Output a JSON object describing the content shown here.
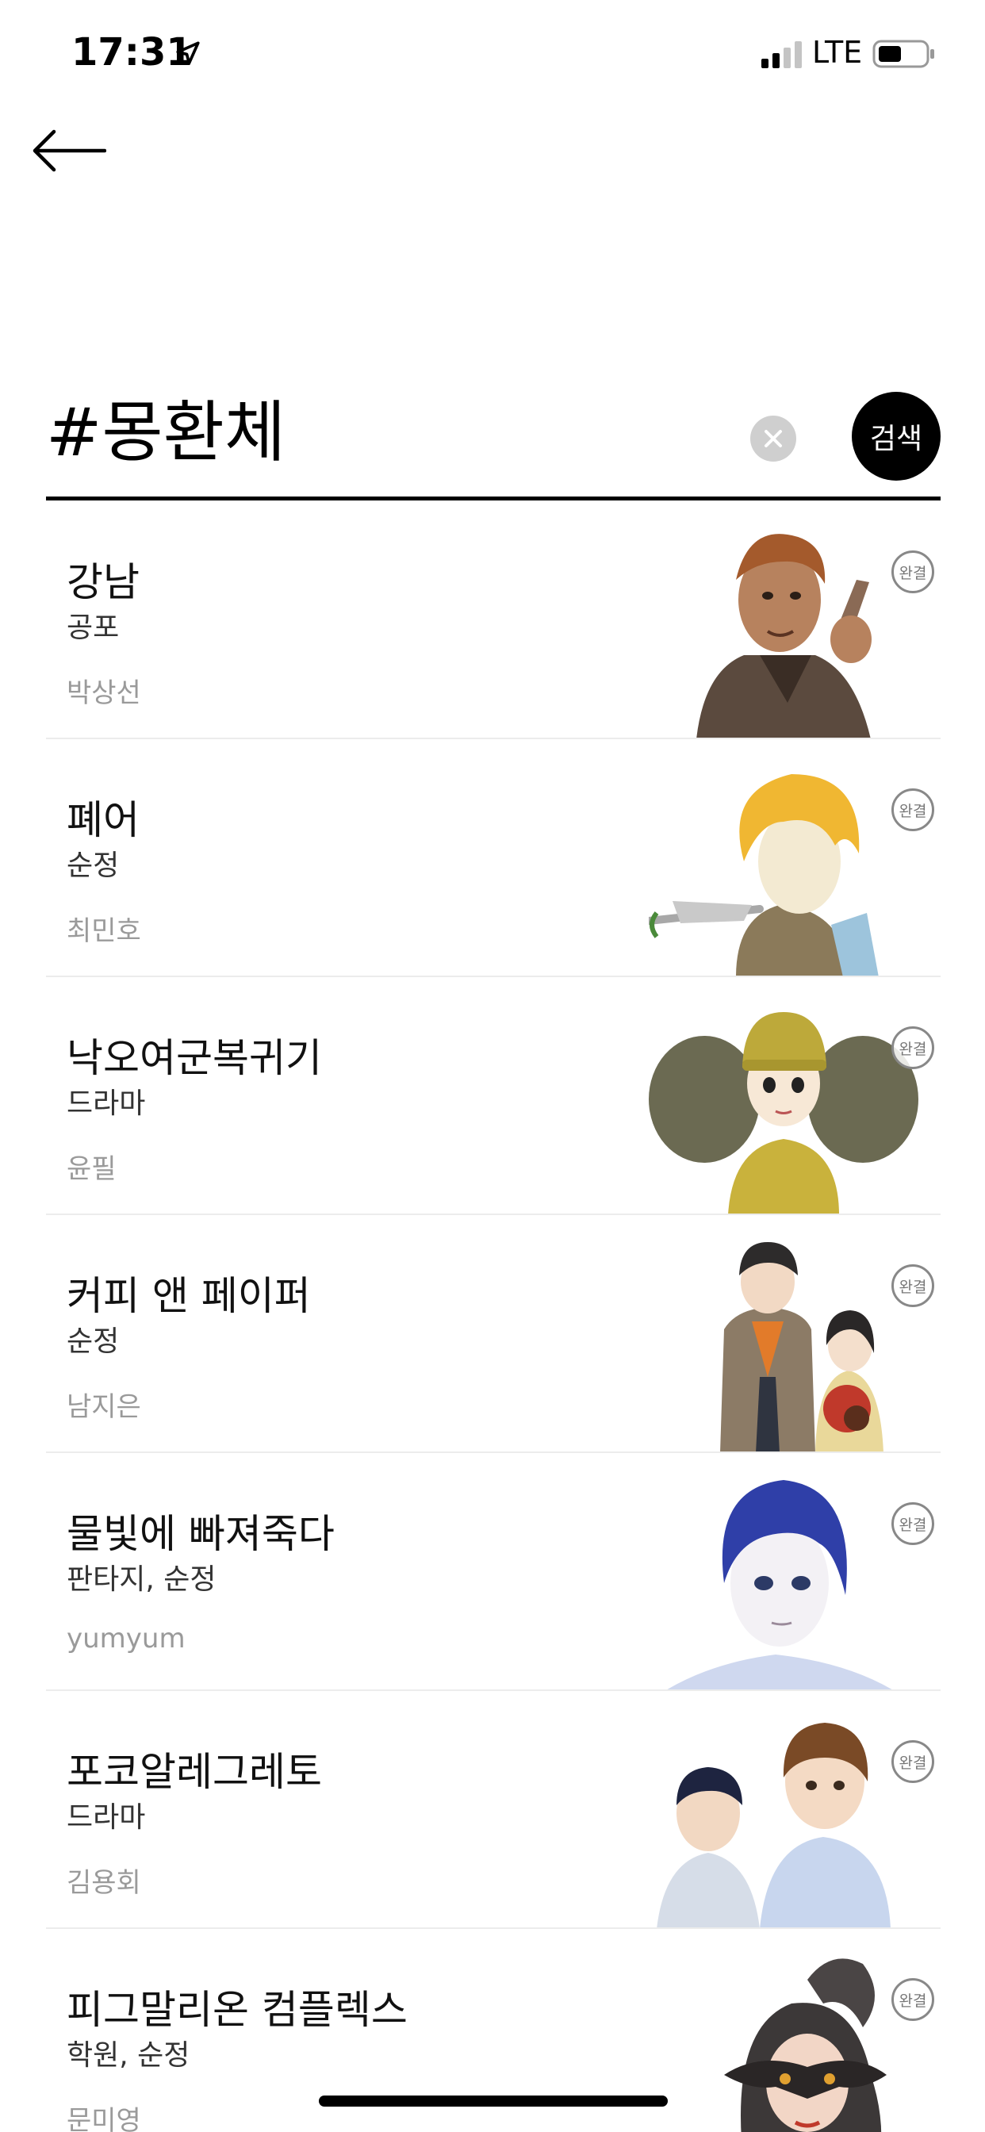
{
  "status_bar": {
    "time": "17:31",
    "network": "LTE"
  },
  "search": {
    "query": "#몽환체",
    "button_label": "검색"
  },
  "results": [
    {
      "title": "강남",
      "genre": "공포",
      "author": "박상선",
      "badge": "완결"
    },
    {
      "title": "폐어",
      "genre": "순정",
      "author": "최민호",
      "badge": "완결"
    },
    {
      "title": "낙오여군복귀기",
      "genre": "드라마",
      "author": "윤필",
      "badge": "완결"
    },
    {
      "title": "커피 앤 페이퍼",
      "genre": "순정",
      "author": "남지은",
      "badge": "완결"
    },
    {
      "title": "물빛에 빠져죽다",
      "genre": "판타지, 순정",
      "author": "yumyum",
      "badge": "완결"
    },
    {
      "title": "포코알레그레토",
      "genre": "드라마",
      "author": "김용회",
      "badge": "완결"
    },
    {
      "title": "피그말리온 컴플렉스",
      "genre": "학원, 순정",
      "author": "문미영",
      "badge": "완결"
    }
  ],
  "colors": {
    "accent": "#000000",
    "muted_text": "#9a9a9a",
    "divider": "#ececec"
  }
}
